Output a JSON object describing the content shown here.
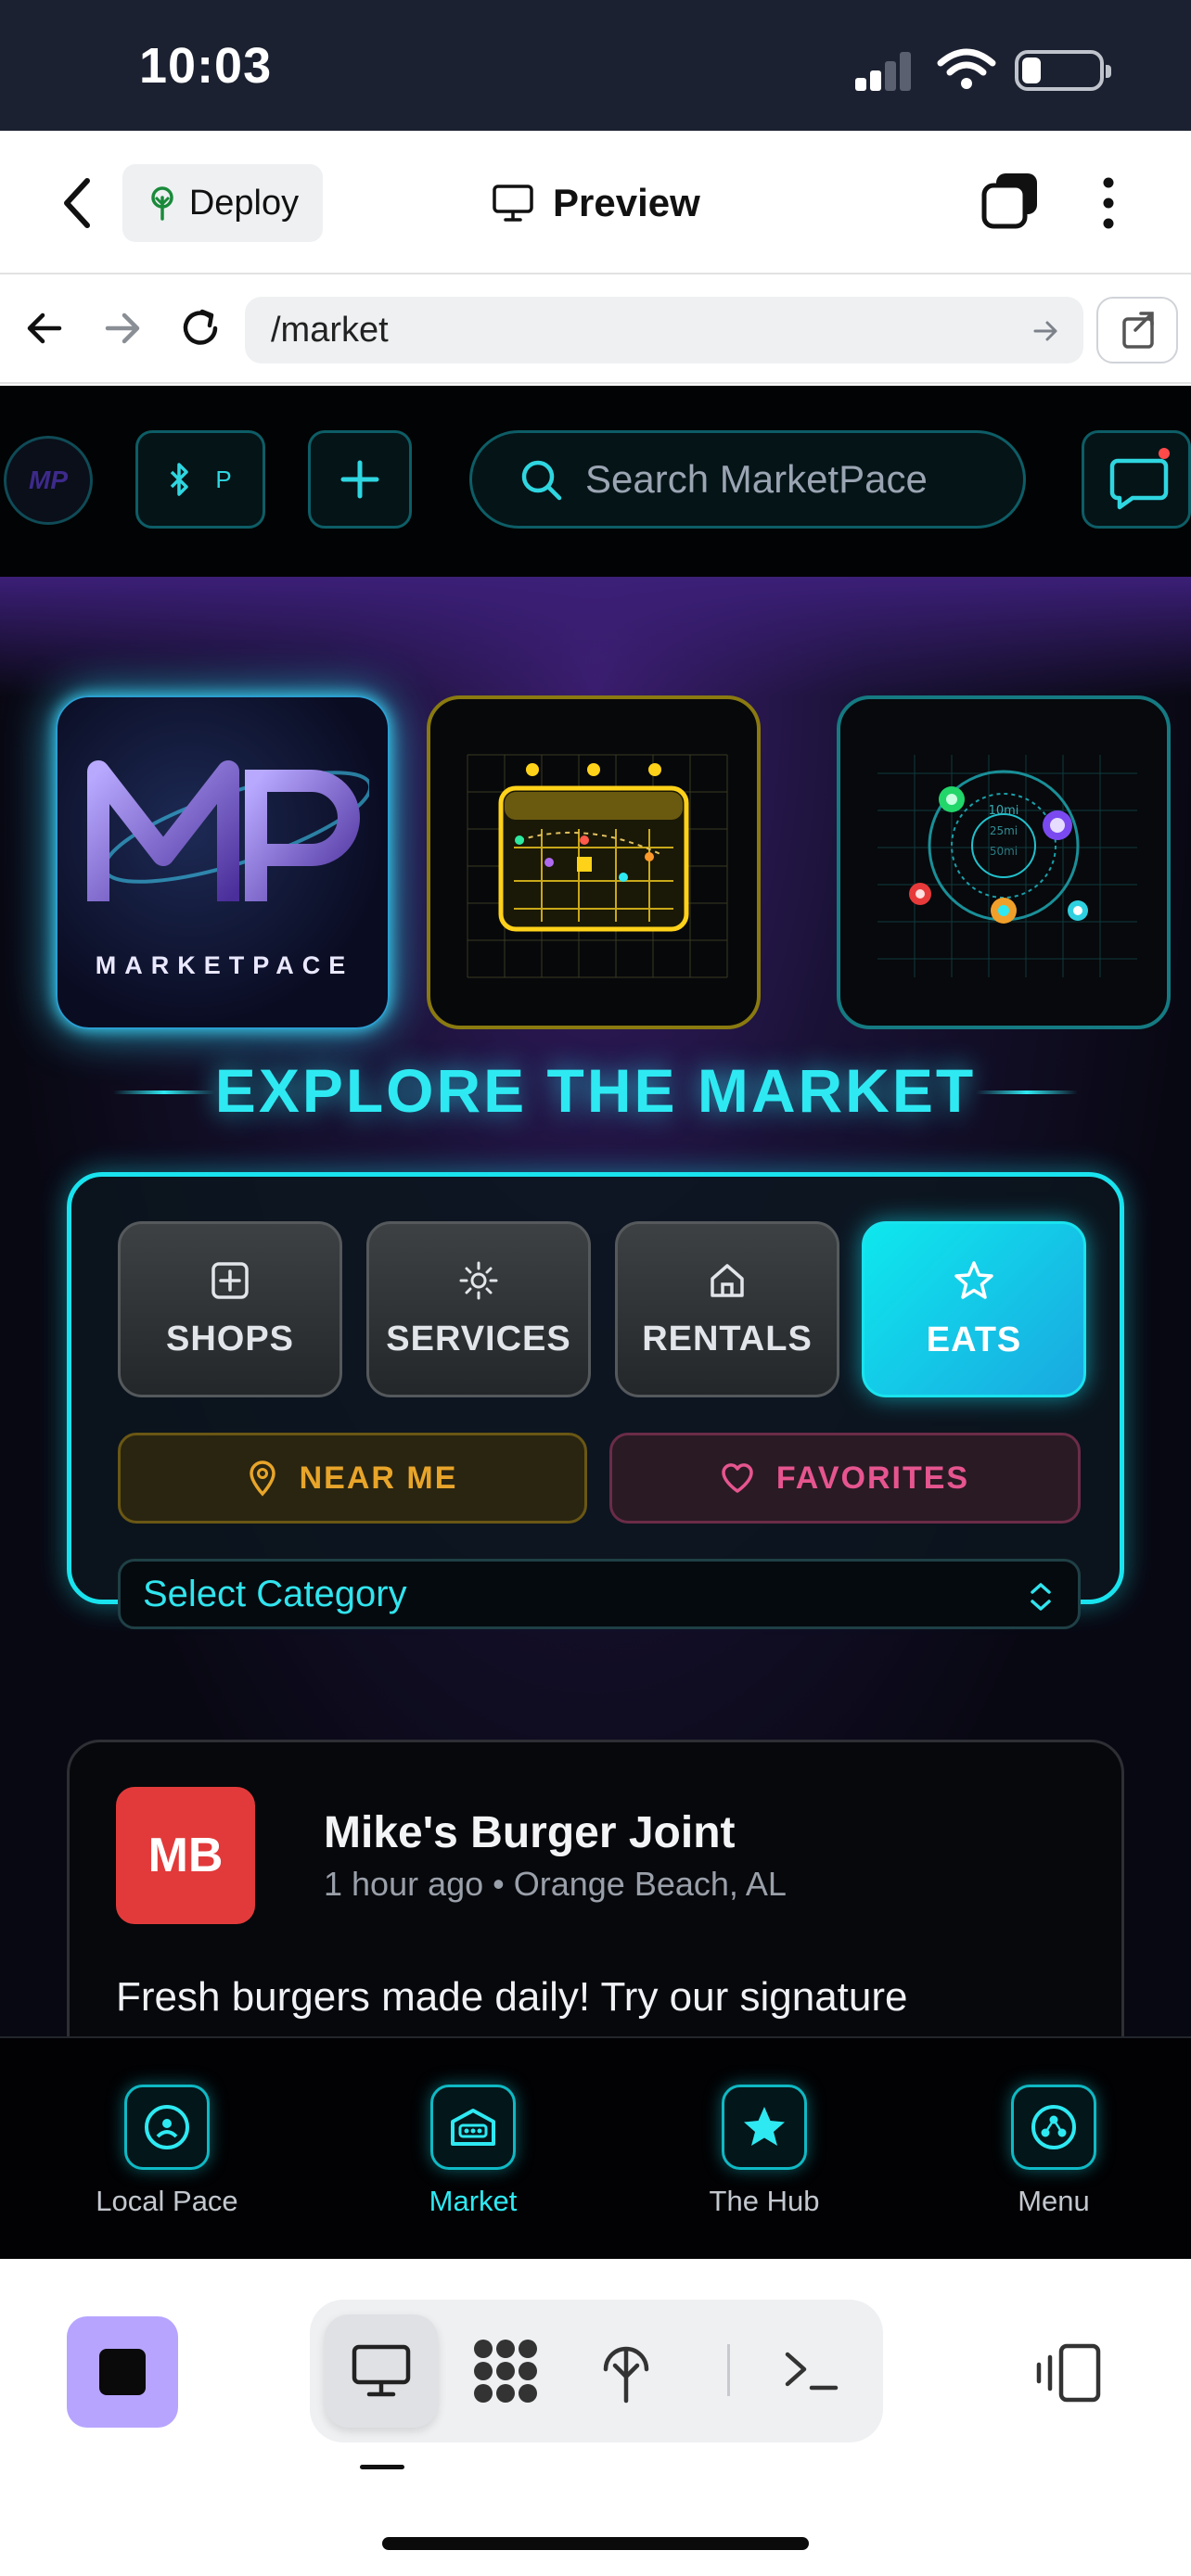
{
  "status_bar": {
    "time": "10:03"
  },
  "app_bar": {
    "deploy_label": "Deploy",
    "title": "Preview"
  },
  "browser": {
    "url": "/market"
  },
  "site": {
    "logo_badge": "MP",
    "bt_badge": "P",
    "search_placeholder": "Search MarketPace",
    "hero": {
      "logo_wordmark": "MARKETPACE",
      "radar_labels": [
        "10mi",
        "25mi",
        "50mi"
      ]
    },
    "heading": "EXPLORE THE MARKET",
    "categories": [
      {
        "label": "SHOPS",
        "icon": "plus-square-icon",
        "active": false
      },
      {
        "label": "SERVICES",
        "icon": "sun-icon",
        "active": false
      },
      {
        "label": "RENTALS",
        "icon": "home-icon",
        "active": false
      },
      {
        "label": "EATS",
        "icon": "star-icon",
        "active": true
      }
    ],
    "near_me_label": "NEAR ME",
    "favorites_label": "FAVORITES",
    "select_category": "Select Category",
    "listing": {
      "avatar_initials": "MB",
      "name": "Mike's Burger Joint",
      "meta": "1 hour ago • Orange Beach, AL",
      "description": "Fresh burgers made daily! Try our signature"
    },
    "bottom_nav": [
      {
        "label": "Local Pace",
        "icon": "local-pace-icon",
        "active": false
      },
      {
        "label": "Market",
        "icon": "market-icon",
        "active": true
      },
      {
        "label": "The Hub",
        "icon": "star-icon",
        "active": false
      },
      {
        "label": "Menu",
        "icon": "menu-icon",
        "active": false
      }
    ]
  },
  "colors": {
    "accent_cyan": "#19e3ee",
    "near_me": "#e8a52a",
    "favorites": "#e6558f",
    "avatar_red": "#e23a3a",
    "stop_button": "#b7a4ff"
  }
}
